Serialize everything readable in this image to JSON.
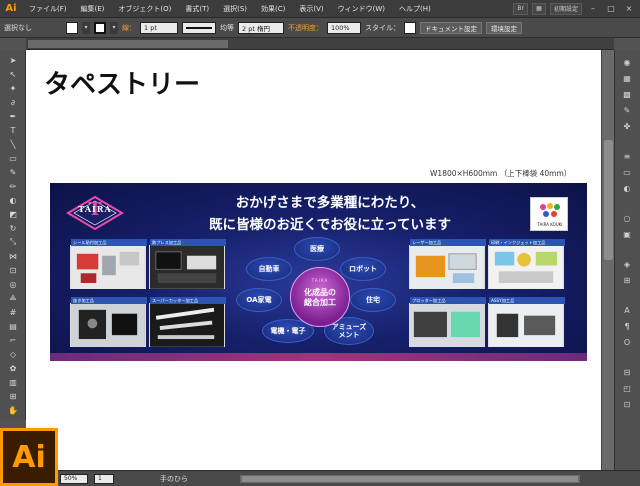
{
  "app": {
    "logo": "Ai"
  },
  "menubar": {
    "items": [
      "ファイル(F)",
      "編集(E)",
      "オブジェクト(O)",
      "書式(T)",
      "選択(S)",
      "効果(C)",
      "表示(V)",
      "ウィンドウ(W)",
      "ヘルプ(H)"
    ],
    "workspace": "初期設定"
  },
  "controlbar": {
    "selection": "選択なし",
    "stroke_label": "線：",
    "stroke_weight": "1 pt",
    "stroke_profile": "均等",
    "brush": "2 pt 楕円",
    "opacity_label": "不透明度：",
    "opacity": "100%",
    "style_label": "スタイル：",
    "doc_setup": "ドキュメント設定",
    "prefs": "環境設定"
  },
  "doctab": {
    "label": "\u0000"
  },
  "canvas": {
    "title": "タペストリー",
    "size_note": "W1800×H600mm （上下棒袋 40mm）"
  },
  "banner": {
    "logo_text": "TAIRA",
    "headline1": "おかげさまで多業種にわたり、",
    "headline2": "既に皆様のお近くでお役に立っています",
    "badge_text": "TAIRA KOUKI",
    "center_small": "TAIRA",
    "center_text": "化成品の\n総合加工",
    "bubbles": [
      "医療",
      "自動車",
      "ロボット",
      "OA家電",
      "住宅",
      "電機・電子",
      "アミューズ\nメント"
    ],
    "cards": [
      {
        "caption": "シール貼付加工品"
      },
      {
        "caption": "熱プレス加工品"
      },
      {
        "caption": "抜き加工品"
      },
      {
        "caption": "スーパーカッター加工品"
      },
      {
        "caption": "レーザー加工品"
      },
      {
        "caption": "印刷・インクジェット加工品"
      },
      {
        "caption": "プロッター加工品"
      },
      {
        "caption": "ASSY加工品"
      }
    ]
  },
  "statusbar": {
    "zoom": "50%",
    "page": "1",
    "tool": "手のひら"
  },
  "colors": {
    "accent": "#ff9a00",
    "banner_bg": "#16206a",
    "center": "#9a2bb0"
  }
}
